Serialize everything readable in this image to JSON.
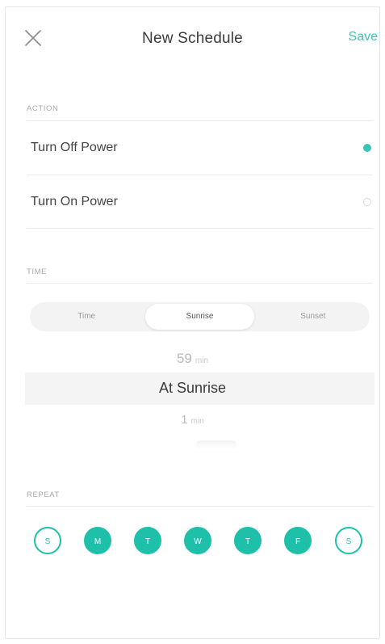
{
  "header": {
    "title": "New Schedule",
    "save_label": "Save",
    "close_icon": "close-icon"
  },
  "accent_color": "#3cc4b4",
  "action": {
    "label": "ACTION",
    "options": [
      {
        "label": "Turn Off Power",
        "selected": true
      },
      {
        "label": "Turn On Power",
        "selected": false
      }
    ]
  },
  "time": {
    "label": "TIME",
    "tabs": [
      {
        "label": "Time",
        "active": false
      },
      {
        "label": "Sunrise",
        "active": true
      },
      {
        "label": "Sunset",
        "active": false
      }
    ],
    "picker": {
      "above_value": "59",
      "above_unit": "min",
      "selected": "At Sunrise",
      "below_value": "1",
      "below_unit": "min"
    }
  },
  "repeat": {
    "label": "REPEAT",
    "days": [
      {
        "label": "S",
        "selected": false
      },
      {
        "label": "M",
        "selected": true
      },
      {
        "label": "T",
        "selected": true
      },
      {
        "label": "W",
        "selected": true
      },
      {
        "label": "T",
        "selected": true
      },
      {
        "label": "F",
        "selected": true
      },
      {
        "label": "S",
        "selected": false
      }
    ]
  }
}
